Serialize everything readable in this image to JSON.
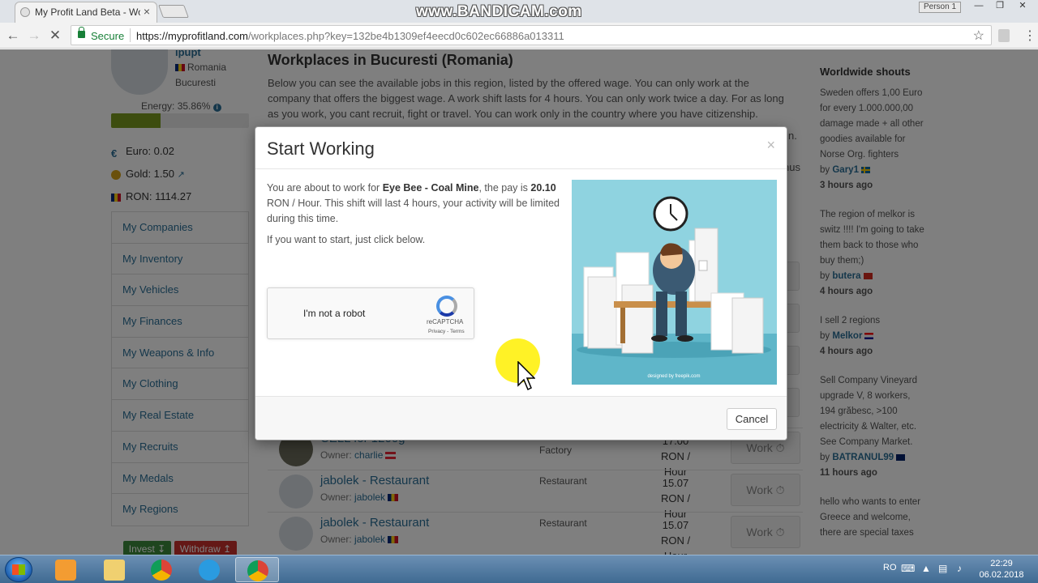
{
  "browser": {
    "tab_title": "My Profit Land Beta - Wo",
    "tab_close": "×",
    "watermark": "www.BANDICAM.com",
    "profile": "Person 1",
    "window_buttons": [
      "—",
      "❐",
      "✕"
    ],
    "secure_label": "Secure",
    "url_host": "https://myprofitland.com",
    "url_path": "/workplaces.php?key=132be4b1309ef4eecd0c602ec66886a013311",
    "back_icon": "arrow-left-icon",
    "forward_icon": "arrow-right-icon",
    "reload_icon": "close-stop-icon"
  },
  "sidebar": {
    "username": "ipupt",
    "country": "Romania",
    "city": "Bucuresti",
    "energy_label": "Energy: 35.86%",
    "energy_level": 0.3586,
    "euro": "Euro: 0.02",
    "gold": "Gold: 1.50",
    "ron": "RON: 1114.27",
    "menu": [
      "My Companies",
      "My Inventory",
      "My Vehicles",
      "My Finances",
      "My Weapons & Info",
      "My Clothing",
      "My Real Estate",
      "My Recruits",
      "My Medals",
      "My Regions"
    ],
    "invest": "Invest",
    "withdraw": "Withdraw"
  },
  "main": {
    "title": "Workplaces in Bucuresti (Romania)",
    "description": "Below you can see the available jobs in this region, listed by the offered wage. You can only work at the company that offers the biggest wage. A work shift lasts for 4 hours. You can only work twice a day. For as long as you work, you cant recruit, fight or travel. You can work only in the country where you have citizenship.",
    "peek_n": "n.",
    "peek_nus": "nus",
    "jobs": [
      {
        "name": "CELL for 1200g",
        "owner_label": "Owner:",
        "owner": "charlie",
        "type": "Factory",
        "wage": "17.00",
        "unit": "RON / Hour",
        "button": "Work ⏱"
      },
      {
        "name": "jabolek - Restaurant",
        "owner_label": "Owner:",
        "owner": "jabolek",
        "type": "Restaurant",
        "wage": "15.07",
        "unit": "RON / Hour",
        "button": "Work ⏱"
      },
      {
        "name": "jabolek - Restaurant",
        "owner_label": "Owner:",
        "owner": "jabolek",
        "type": "Restaurant",
        "wage": "15.07",
        "unit": "RON / Hour",
        "button": "Work ⏱"
      }
    ]
  },
  "shouts": {
    "title": "Worldwide shouts",
    "items": [
      {
        "text": "Sweden offers 1,00 Euro for every 1.000.000,00 damage made + all other goodies available for Norse Org. fighters",
        "by_label": "by",
        "author": "Gary1",
        "time": "3 hours ago"
      },
      {
        "text": "The region of melkor is switz !!!! I'm going to take them back to those who buy them;)",
        "by_label": "by",
        "author": "butera",
        "time": "4 hours ago"
      },
      {
        "text": "I sell 2 regions",
        "by_label": "by",
        "author": "Melkor",
        "time": "4 hours ago"
      },
      {
        "text": "Sell Company Vineyard upgrade V, 8 workers, 194 grăbesc, >100 electricity & Walter, etc. See Company Market.",
        "by_label": "by",
        "author": "BATRANUL99",
        "time": "11 hours ago"
      },
      {
        "text": "hello who wants to enter Greece and welcome, there are special taxes",
        "by_label": "",
        "author": "",
        "time": ""
      }
    ]
  },
  "modal": {
    "title": "Start Working",
    "close": "×",
    "text_prefix": "You are about to work for ",
    "company": "Eye Bee - Coal Mine",
    "text_mid": ", the pay is ",
    "wage": "20.10",
    "text_suffix": " RON / Hour. This shift will last 4 hours, your activity will be limited during this time.",
    "start_hint": "If you want to start, just click below.",
    "captcha_label": "I'm not a robot",
    "captcha_brand": "reCAPTCHA",
    "captcha_terms": "Privacy - Terms",
    "image_credit": "designed by freepik.com",
    "cancel": "Cancel"
  },
  "taskbar": {
    "lang": "RO",
    "time": "22:29",
    "date": "06.02.2018"
  },
  "colors": {
    "link": "#2a6f97",
    "energy": "#7a9a1e",
    "invest": "#3d8b3d",
    "withdraw": "#c9302c",
    "secure": "#188038"
  }
}
